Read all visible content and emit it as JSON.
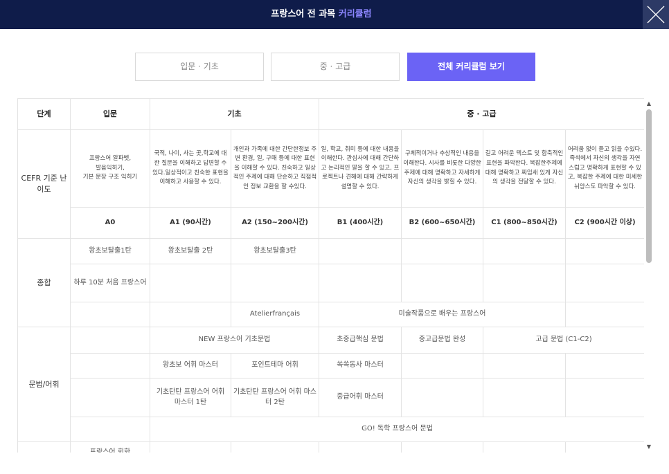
{
  "header": {
    "title_prefix": "프랑스어 전 과목 ",
    "title_accent": "커리큘럼"
  },
  "tabs": [
    {
      "label": "입문 · 기초"
    },
    {
      "label": "중 · 고급"
    },
    {
      "label": "전체 커리큘럼 보기"
    }
  ],
  "table": {
    "headers": {
      "stage": "단계",
      "intro": "입문",
      "basic": "기초",
      "inter": "중 · 고급"
    },
    "cefr": {
      "row_label": "CEFR 기준 난이도",
      "descriptions": [
        "프랑스어 알파벳,\n발음익히기,\n기본 문장 구조 익히기",
        "국적, 나이, 사는 곳,학교에 대한 질문을 이해하고 답변할 수 있다.일상적이고 친숙한 표현을 이해하고 사용할 수 있다.",
        "개인과 가족에 대한 간단한정보 주변 환경, 일, 구매 등에 대한 표현을 이해할 수 있다. 친숙하고 일상적인 주제에 대해 단순하고 직접적인 정보 교환을 할 수있다.",
        "일, 학교, 취미 등에 대한 내용을 이해한다. 관심사에 대해 간단하고 논리적인 말을 할 수 있고, 프로젝트나 견해에 대해 간략하게 설명할 수 있다.",
        "구체적이거나 추상적인 내용을 이해한다. 시사를 비롯한 다양한 주제에 대해 명확하고 자세하게 자신의 생각을 밝힐 수 있다.",
        "길고 어려운 텍스트 및 함축적인 표현을 파악한다. 복잡한주제에 대해 명확하고 짜임새 있게 자신의 생각을 전달할 수 있다.",
        "어려움 없이 듣고 읽을 수있다. 즉석에서 자신의 생각을 자연스럽고 명확하게 표현할 수 있고, 복잡한 주제에 대한 미세한 뉘앙스도 파악할 수 있다."
      ],
      "levels": [
        "A0",
        "A1 (90시간)",
        "A2 (150~200시간)",
        "B1 (400시간)",
        "B2 (600~650시간)",
        "C1 (800~850시간)",
        "C2 (900시간 이상)"
      ]
    },
    "general": {
      "row_label": "종합",
      "r1": [
        "왕초보탈출1탄",
        "왕초보탈출 2탄",
        "왕초보탈출3탄"
      ],
      "r2": "하루 10분 처음 프랑스어",
      "r3_a": "Atelierfrançais",
      "r3_b": "미술작품으로 배우는 프랑스어"
    },
    "grammar": {
      "row_label": "문법/어휘",
      "r1": [
        "NEW 프랑스어 기초문법",
        "초중급핵심 문법",
        "중고급문법 완성",
        "고급 문법 (C1-C2)"
      ],
      "r2": [
        "왕초보 어휘 마스터",
        "포인트테마 어휘",
        "쏙쏙동사 마스터"
      ],
      "r3": [
        "기초탄탄 프랑스어 어휘 마스터 1탄",
        "기초탄탄 프랑스어 어휘 마스터 2탄",
        "중급어휘 마스터"
      ],
      "r4": "GO! 독학 프랑스어 문법"
    },
    "partial_next_row": "프랑스어 회화"
  },
  "colors": {
    "header_bg": "#0f1c4a",
    "accent": "#8c86ff",
    "active_tab": "#6b63f5"
  },
  "icons": {
    "close": "close-icon",
    "scroll_up": "scroll-up-arrow",
    "scroll_down": "scroll-down-arrow"
  }
}
